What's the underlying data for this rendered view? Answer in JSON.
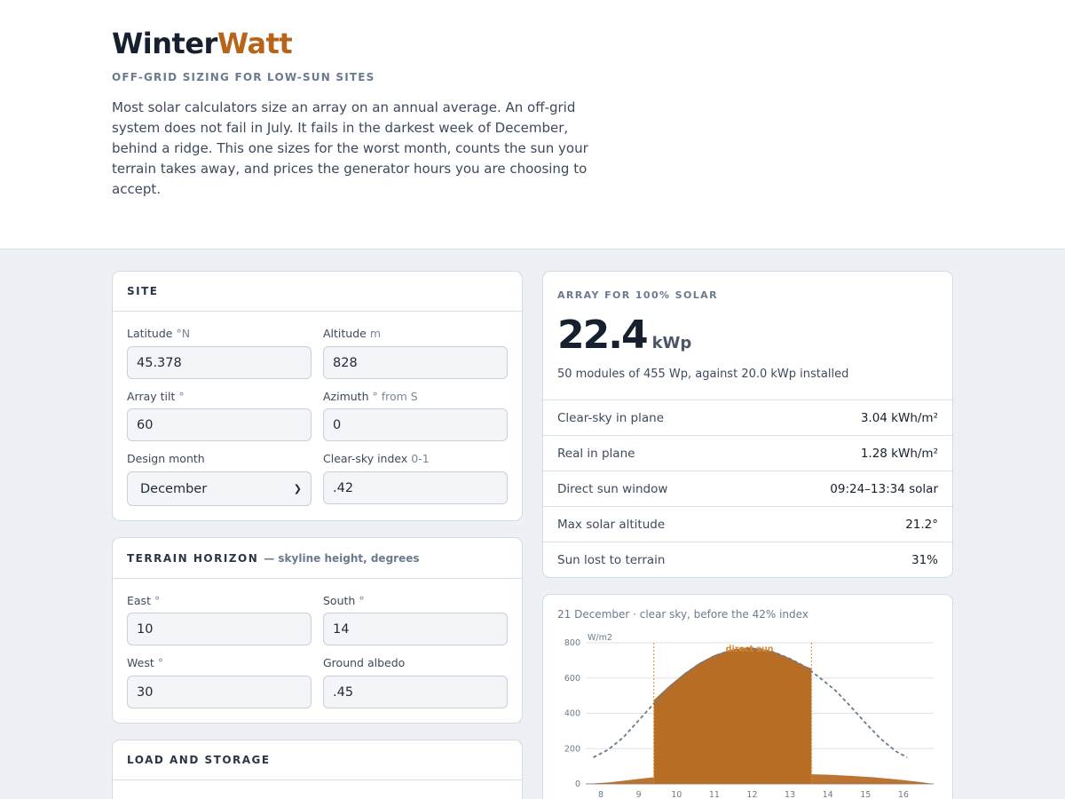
{
  "brand": {
    "part1": "Winter",
    "part2": "Watt"
  },
  "tagline": "OFF-GRID SIZING FOR LOW-SUN SITES",
  "intro": "Most solar calculators size an array on an annual average. An off-grid system does not fail in July. It fails in the darkest week of December, behind a ridge. This one sizes for the worst month, counts the sun your terrain takes away, and prices the generator hours you are choosing to accept.",
  "site": {
    "title": "SITE",
    "latitude": {
      "label": "Latitude",
      "unit": "°N",
      "value": "45.378"
    },
    "altitude": {
      "label": "Altitude",
      "unit": "m",
      "value": "828"
    },
    "tilt": {
      "label": "Array tilt",
      "unit": "°",
      "value": "60"
    },
    "azimuth": {
      "label": "Azimuth",
      "unit": "° from S",
      "value": "0"
    },
    "month": {
      "label": "Design month",
      "value": "December"
    },
    "clearsky": {
      "label": "Clear-sky index",
      "unit": "0-1",
      "value": ".42"
    }
  },
  "horizon": {
    "title": "TERRAIN HORIZON",
    "subtitle": "— skyline height, degrees",
    "east": {
      "label": "East",
      "unit": "°",
      "value": "10"
    },
    "south": {
      "label": "South",
      "unit": "°",
      "value": "14"
    },
    "west": {
      "label": "West",
      "unit": "°",
      "value": "30"
    },
    "albedo": {
      "label": "Ground albedo",
      "value": ".45"
    }
  },
  "load": {
    "title": "LOAD AND STORAGE"
  },
  "result": {
    "eyebrow": "ARRAY FOR 100% SOLAR",
    "value": "22.4",
    "unit": "kWp",
    "summary": "50 modules of 455 Wp, against 20.0 kWp installed",
    "rows": [
      {
        "label": "Clear-sky in plane",
        "value": "3.04 kWh/m²"
      },
      {
        "label": "Real in plane",
        "value": "1.28 kWh/m²"
      },
      {
        "label": "Direct sun window",
        "value": "09:24–13:34 solar"
      },
      {
        "label": "Max solar altitude",
        "value": "21.2°"
      },
      {
        "label": "Sun lost to terrain",
        "value": "31%"
      }
    ]
  },
  "chart_caption": "21 December · clear sky, before the 42% index",
  "colors": {
    "accent": "#b6651b",
    "text": "#16202e",
    "muted": "#6b7a8f",
    "background": "#edf1f5"
  },
  "chart_data": {
    "type": "area",
    "ylabel": "W/m2",
    "ylim": [
      0,
      800
    ],
    "yticks": [
      0,
      200,
      400,
      600,
      800
    ],
    "xticks": [
      8,
      9,
      10,
      11,
      12,
      13,
      14,
      15,
      16
    ],
    "xlim": [
      7.6,
      16.8
    ],
    "annotation": "direct sun",
    "window": [
      9.4,
      13.57
    ],
    "series": [
      {
        "kind": "clear-sky-dashed",
        "x": [
          7.8,
          8.2,
          8.6,
          9.0,
          9.4,
          9.8,
          10.2,
          10.6,
          11.0,
          11.4,
          11.8,
          12.2,
          12.6,
          13.0,
          13.4,
          13.8,
          14.2,
          14.6,
          15.0,
          15.4,
          15.8,
          16.1
        ],
        "y": [
          150,
          195,
          265,
          360,
          455,
          545,
          620,
          680,
          725,
          755,
          770,
          765,
          745,
          710,
          665,
          600,
          530,
          440,
          345,
          255,
          185,
          150
        ]
      },
      {
        "kind": "direct-fill",
        "x": [
          9.4,
          9.8,
          10.2,
          10.6,
          11.0,
          11.4,
          11.8,
          12.2,
          12.6,
          13.0,
          13.4,
          13.57
        ],
        "y": [
          475,
          555,
          625,
          685,
          730,
          758,
          772,
          767,
          747,
          712,
          668,
          655
        ]
      },
      {
        "kind": "diffuse-fill",
        "x": [
          7.6,
          8.2,
          8.6,
          9.0,
          9.4,
          9.8,
          10.6,
          11.4,
          12.2,
          13.0,
          13.57,
          14.0,
          14.6,
          15.2,
          15.8,
          16.4,
          16.8
        ],
        "y": [
          0,
          8,
          18,
          28,
          38,
          45,
          55,
          60,
          62,
          60,
          55,
          52,
          46,
          38,
          26,
          12,
          0
        ]
      }
    ]
  }
}
